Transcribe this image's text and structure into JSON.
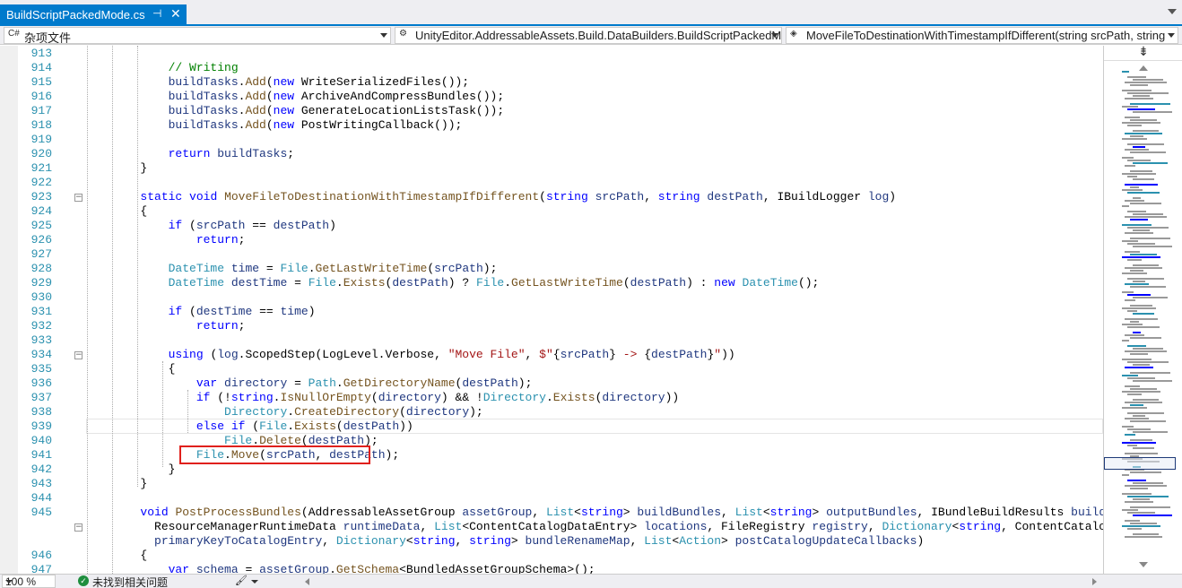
{
  "tab": {
    "title": "BuildScriptPackedMode.cs",
    "pin_glyph": "⊣",
    "close_glyph": "✕"
  },
  "nav": {
    "project": {
      "icon": "C#",
      "label": "杂项文件"
    },
    "type": {
      "label": "UnityEditor.AddressableAssets.Build.DataBuilders.BuildScriptPackedM"
    },
    "member": {
      "label": "MoveFileToDestinationWithTimestampIfDifferent(string srcPath, string"
    }
  },
  "code_lines": [
    {
      "n": "913",
      "tokens": []
    },
    {
      "n": "914",
      "tokens": [
        [
          "            ",
          ""
        ],
        [
          "// Writing",
          "cm"
        ]
      ]
    },
    {
      "n": "915",
      "tokens": [
        [
          "            ",
          ""
        ],
        [
          "buildTasks",
          "lo"
        ],
        [
          ".",
          ""
        ],
        [
          "Add",
          "me"
        ],
        [
          "(",
          ""
        ],
        [
          "new",
          "kw"
        ],
        [
          " WriteSerializedFiles());",
          ""
        ]
      ]
    },
    {
      "n": "916",
      "tokens": [
        [
          "            ",
          ""
        ],
        [
          "buildTasks",
          "lo"
        ],
        [
          ".",
          ""
        ],
        [
          "Add",
          "me"
        ],
        [
          "(",
          ""
        ],
        [
          "new",
          "kw"
        ],
        [
          " ArchiveAndCompressBundles());",
          ""
        ]
      ]
    },
    {
      "n": "917",
      "tokens": [
        [
          "            ",
          ""
        ],
        [
          "buildTasks",
          "lo"
        ],
        [
          ".",
          ""
        ],
        [
          "Add",
          "me"
        ],
        [
          "(",
          ""
        ],
        [
          "new",
          "kw"
        ],
        [
          " GenerateLocationListsTask());",
          ""
        ]
      ]
    },
    {
      "n": "918",
      "tokens": [
        [
          "            ",
          ""
        ],
        [
          "buildTasks",
          "lo"
        ],
        [
          ".",
          ""
        ],
        [
          "Add",
          "me"
        ],
        [
          "(",
          ""
        ],
        [
          "new",
          "kw"
        ],
        [
          " PostWritingCallback());",
          ""
        ]
      ]
    },
    {
      "n": "919",
      "tokens": []
    },
    {
      "n": "920",
      "tokens": [
        [
          "            ",
          ""
        ],
        [
          "return",
          "kw"
        ],
        [
          " ",
          ""
        ],
        [
          "buildTasks",
          "lo"
        ],
        [
          ";",
          ""
        ]
      ]
    },
    {
      "n": "921",
      "tokens": [
        [
          "        }",
          ""
        ]
      ]
    },
    {
      "n": "922",
      "tokens": []
    },
    {
      "n": "923",
      "tokens": [
        [
          "        ",
          ""
        ],
        [
          "static",
          "kw"
        ],
        [
          " ",
          ""
        ],
        [
          "void",
          "kw"
        ],
        [
          " ",
          ""
        ],
        [
          "MoveFileToDestinationWithTimestampIfDifferent",
          "me"
        ],
        [
          "(",
          ""
        ],
        [
          "string",
          "kw"
        ],
        [
          " ",
          ""
        ],
        [
          "srcPath",
          "lo"
        ],
        [
          ", ",
          ""
        ],
        [
          "string",
          "kw"
        ],
        [
          " ",
          ""
        ],
        [
          "destPath",
          "lo"
        ],
        [
          ", IBuildLogger ",
          ""
        ],
        [
          "log",
          "lo"
        ],
        [
          ")",
          ""
        ]
      ]
    },
    {
      "n": "924",
      "tokens": [
        [
          "        {",
          ""
        ]
      ]
    },
    {
      "n": "925",
      "tokens": [
        [
          "            ",
          ""
        ],
        [
          "if",
          "kw"
        ],
        [
          " (",
          ""
        ],
        [
          "srcPath",
          "lo"
        ],
        [
          " == ",
          ""
        ],
        [
          "destPath",
          "lo"
        ],
        [
          ")",
          ""
        ]
      ]
    },
    {
      "n": "926",
      "tokens": [
        [
          "                ",
          ""
        ],
        [
          "return",
          "kw"
        ],
        [
          ";",
          ""
        ]
      ]
    },
    {
      "n": "927",
      "tokens": []
    },
    {
      "n": "928",
      "tokens": [
        [
          "            ",
          ""
        ],
        [
          "DateTime",
          "ty"
        ],
        [
          " ",
          ""
        ],
        [
          "time",
          "lo"
        ],
        [
          " = ",
          ""
        ],
        [
          "File",
          "ty"
        ],
        [
          ".",
          ""
        ],
        [
          "GetLastWriteTime",
          "me"
        ],
        [
          "(",
          ""
        ],
        [
          "srcPath",
          "lo"
        ],
        [
          ");",
          ""
        ]
      ]
    },
    {
      "n": "929",
      "tokens": [
        [
          "            ",
          ""
        ],
        [
          "DateTime",
          "ty"
        ],
        [
          " ",
          ""
        ],
        [
          "destTime",
          "lo"
        ],
        [
          " = ",
          ""
        ],
        [
          "File",
          "ty"
        ],
        [
          ".",
          ""
        ],
        [
          "Exists",
          "me"
        ],
        [
          "(",
          ""
        ],
        [
          "destPath",
          "lo"
        ],
        [
          ") ? ",
          ""
        ],
        [
          "File",
          "ty"
        ],
        [
          ".",
          ""
        ],
        [
          "GetLastWriteTime",
          "me"
        ],
        [
          "(",
          ""
        ],
        [
          "destPath",
          "lo"
        ],
        [
          ") : ",
          ""
        ],
        [
          "new",
          "kw"
        ],
        [
          " ",
          ""
        ],
        [
          "DateTime",
          "ty"
        ],
        [
          "();",
          ""
        ]
      ]
    },
    {
      "n": "930",
      "tokens": []
    },
    {
      "n": "931",
      "tokens": [
        [
          "            ",
          ""
        ],
        [
          "if",
          "kw"
        ],
        [
          " (",
          ""
        ],
        [
          "destTime",
          "lo"
        ],
        [
          " == ",
          ""
        ],
        [
          "time",
          "lo"
        ],
        [
          ")",
          ""
        ]
      ]
    },
    {
      "n": "932",
      "tokens": [
        [
          "                ",
          ""
        ],
        [
          "return",
          "kw"
        ],
        [
          ";",
          ""
        ]
      ]
    },
    {
      "n": "933",
      "tokens": []
    },
    {
      "n": "934",
      "tokens": [
        [
          "            ",
          ""
        ],
        [
          "using",
          "kw"
        ],
        [
          " (",
          ""
        ],
        [
          "log",
          "lo"
        ],
        [
          ".ScopedStep(LogLevel.Verbose, ",
          ""
        ],
        [
          "\"Move File\"",
          "st"
        ],
        [
          ", ",
          ""
        ],
        [
          "$\"",
          "st"
        ],
        [
          "{",
          ""
        ],
        [
          "srcPath",
          "lo"
        ],
        [
          "}",
          ""
        ],
        [
          " -> ",
          "st"
        ],
        [
          "{",
          ""
        ],
        [
          "destPath",
          "lo"
        ],
        [
          "}",
          ""
        ],
        [
          "\"",
          "st"
        ],
        [
          "))",
          ""
        ]
      ]
    },
    {
      "n": "935",
      "tokens": [
        [
          "            {",
          ""
        ]
      ]
    },
    {
      "n": "936",
      "tokens": [
        [
          "                ",
          ""
        ],
        [
          "var",
          "kw"
        ],
        [
          " ",
          ""
        ],
        [
          "directory",
          "lo"
        ],
        [
          " = ",
          ""
        ],
        [
          "Path",
          "ty"
        ],
        [
          ".",
          ""
        ],
        [
          "GetDirectoryName",
          "me"
        ],
        [
          "(",
          ""
        ],
        [
          "destPath",
          "lo"
        ],
        [
          ");",
          ""
        ]
      ]
    },
    {
      "n": "937",
      "tokens": [
        [
          "                ",
          ""
        ],
        [
          "if",
          "kw"
        ],
        [
          " (!",
          ""
        ],
        [
          "string",
          "kw"
        ],
        [
          ".",
          ""
        ],
        [
          "IsNullOrEmpty",
          "me"
        ],
        [
          "(",
          ""
        ],
        [
          "directory",
          "lo"
        ],
        [
          ") && !",
          ""
        ],
        [
          "Directory",
          "ty"
        ],
        [
          ".",
          ""
        ],
        [
          "Exists",
          "me"
        ],
        [
          "(",
          ""
        ],
        [
          "directory",
          "lo"
        ],
        [
          "))",
          ""
        ]
      ]
    },
    {
      "n": "938",
      "tokens": [
        [
          "                    ",
          ""
        ],
        [
          "Directory",
          "ty"
        ],
        [
          ".",
          ""
        ],
        [
          "CreateDirectory",
          "me"
        ],
        [
          "(",
          ""
        ],
        [
          "directory",
          "lo"
        ],
        [
          ");",
          ""
        ]
      ]
    },
    {
      "n": "939",
      "tokens": [
        [
          "                ",
          ""
        ],
        [
          "else",
          "kw"
        ],
        [
          " ",
          ""
        ],
        [
          "if",
          "kw"
        ],
        [
          " (",
          ""
        ],
        [
          "File",
          "ty"
        ],
        [
          ".",
          ""
        ],
        [
          "Exists",
          "me"
        ],
        [
          "(",
          ""
        ],
        [
          "destPath",
          "lo"
        ],
        [
          "))",
          ""
        ]
      ]
    },
    {
      "n": "940",
      "tokens": [
        [
          "                    ",
          ""
        ],
        [
          "File",
          "ty"
        ],
        [
          ".",
          ""
        ],
        [
          "Delete",
          "me"
        ],
        [
          "(",
          ""
        ],
        [
          "destPath",
          "lo"
        ],
        [
          ");",
          ""
        ]
      ]
    },
    {
      "n": "941",
      "tokens": [
        [
          "                ",
          ""
        ],
        [
          "File",
          "ty"
        ],
        [
          ".",
          ""
        ],
        [
          "Move",
          "me"
        ],
        [
          "(",
          ""
        ],
        [
          "srcPath",
          "lo"
        ],
        [
          ", ",
          ""
        ],
        [
          "destPath",
          "lo"
        ],
        [
          ");",
          ""
        ]
      ]
    },
    {
      "n": "942",
      "tokens": [
        [
          "            }",
          ""
        ]
      ]
    },
    {
      "n": "943",
      "tokens": [
        [
          "        }",
          ""
        ]
      ]
    },
    {
      "n": "944",
      "tokens": []
    },
    {
      "n": "945",
      "tokens": [
        [
          "        ",
          ""
        ],
        [
          "void",
          "kw"
        ],
        [
          " ",
          ""
        ],
        [
          "PostProcessBundles",
          "me"
        ],
        [
          "(AddressableAssetGroup ",
          ""
        ],
        [
          "assetGroup",
          "lo"
        ],
        [
          ", ",
          ""
        ],
        [
          "List",
          "ty"
        ],
        [
          "<",
          ""
        ],
        [
          "string",
          "kw"
        ],
        [
          "> ",
          ""
        ],
        [
          "buildBundles",
          "lo"
        ],
        [
          ", ",
          ""
        ],
        [
          "List",
          "ty"
        ],
        [
          "<",
          ""
        ],
        [
          "string",
          "kw"
        ],
        [
          "> ",
          ""
        ],
        [
          "outputBundles",
          "lo"
        ],
        [
          ", IBundleBuildResults ",
          ""
        ],
        [
          "buildResult",
          "lo"
        ],
        [
          ",",
          ""
        ]
      ]
    },
    {
      "n": "",
      "tokens": [
        [
          "          ResourceManagerRuntimeData ",
          ""
        ],
        [
          "runtimeData",
          "lo"
        ],
        [
          ", ",
          ""
        ],
        [
          "List",
          "ty"
        ],
        [
          "<ContentCatalogDataEntry> ",
          ""
        ],
        [
          "locations",
          "lo"
        ],
        [
          ", FileRegistry ",
          ""
        ],
        [
          "registry",
          "lo"
        ],
        [
          ", ",
          ""
        ],
        [
          "Dictionary",
          "ty"
        ],
        [
          "<",
          ""
        ],
        [
          "string",
          "kw"
        ],
        [
          ", ContentCatalogDataEntry>",
          ""
        ]
      ]
    },
    {
      "n": "",
      "tokens": [
        [
          "          ",
          ""
        ],
        [
          "primaryKeyToCatalogEntry",
          "lo"
        ],
        [
          ", ",
          ""
        ],
        [
          "Dictionary",
          "ty"
        ],
        [
          "<",
          ""
        ],
        [
          "string",
          "kw"
        ],
        [
          ", ",
          ""
        ],
        [
          "string",
          "kw"
        ],
        [
          "> ",
          ""
        ],
        [
          "bundleRenameMap",
          "lo"
        ],
        [
          ", ",
          ""
        ],
        [
          "List",
          "ty"
        ],
        [
          "<",
          ""
        ],
        [
          "Action",
          "ty"
        ],
        [
          "> ",
          ""
        ],
        [
          "postCatalogUpdateCallbacks",
          "lo"
        ],
        [
          ")",
          ""
        ]
      ]
    },
    {
      "n": "946",
      "tokens": [
        [
          "        {",
          ""
        ]
      ]
    },
    {
      "n": "947",
      "tokens": [
        [
          "            ",
          ""
        ],
        [
          "var",
          "kw"
        ],
        [
          " ",
          ""
        ],
        [
          "schema",
          "lo"
        ],
        [
          " = ",
          ""
        ],
        [
          "assetGroup",
          "lo"
        ],
        [
          ".",
          ""
        ],
        [
          "GetSchema",
          "me"
        ],
        [
          "<BundledAssetGroupSchema>();",
          ""
        ]
      ]
    }
  ],
  "status": {
    "zoom": "100 %",
    "issues_text": "未找到相关问题",
    "issues_icon": "check-circle-icon"
  },
  "colors": {
    "accent": "#007acc",
    "highlight_box": "#e0201c",
    "keyword": "#0000ff",
    "type": "#2b91af",
    "method": "#74531f",
    "local": "#1f377f",
    "string": "#a31515",
    "comment": "#008000"
  }
}
